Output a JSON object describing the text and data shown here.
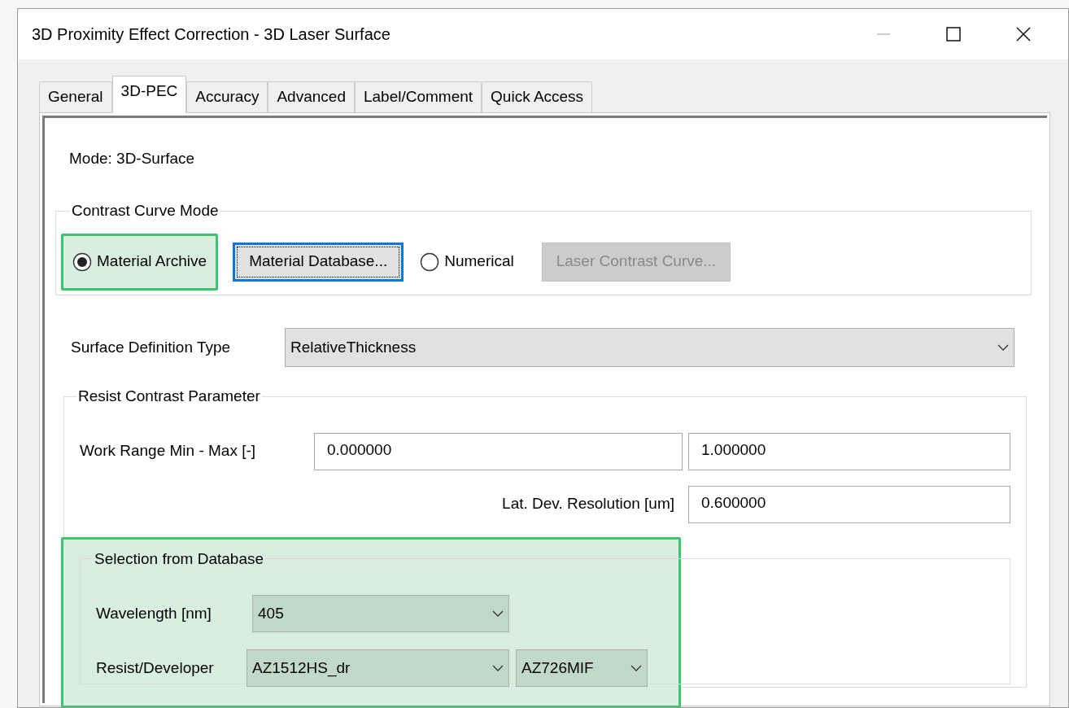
{
  "window": {
    "title": "3D Proximity Effect Correction - 3D Laser Surface"
  },
  "tabs": [
    {
      "label": "General",
      "selected": false
    },
    {
      "label": "3D-PEC",
      "selected": true
    },
    {
      "label": "Accuracy",
      "selected": false
    },
    {
      "label": "Advanced",
      "selected": false
    },
    {
      "label": "Label/Comment",
      "selected": false
    },
    {
      "label": "Quick Access",
      "selected": false
    }
  ],
  "mode_label": "Mode: 3D-Surface",
  "contrast_curve_mode": {
    "title": "Contrast Curve Mode",
    "options": [
      {
        "kind": "radio",
        "label": "Material Archive",
        "selected": true,
        "highlighted": true
      },
      {
        "kind": "button",
        "label": "Material Database...",
        "disabled": false,
        "focused": true
      },
      {
        "kind": "radio",
        "label": "Numerical",
        "selected": false,
        "highlighted": false
      },
      {
        "kind": "button",
        "label": "Laser Contrast Curve...",
        "disabled": true,
        "focused": false
      }
    ]
  },
  "surface_definition": {
    "label": "Surface Definition Type",
    "value": "RelativeThickness"
  },
  "resist_contrast_parameter": {
    "title": "Resist Contrast Parameter",
    "work_range": {
      "label": "Work Range Min - Max [-]",
      "min": "0.000000",
      "max": "1.000000"
    },
    "lat_dev": {
      "label": "Lat. Dev. Resolution [um]",
      "value": "0.600000"
    },
    "selection_from_database": {
      "title": "Selection from Database",
      "highlighted": true,
      "wavelength": {
        "label": "Wavelength [nm]",
        "value": "405"
      },
      "resist_developer": {
        "label": "Resist/Developer",
        "resist": "AZ1512HS_dr",
        "developer": "AZ726MIF"
      }
    }
  }
}
